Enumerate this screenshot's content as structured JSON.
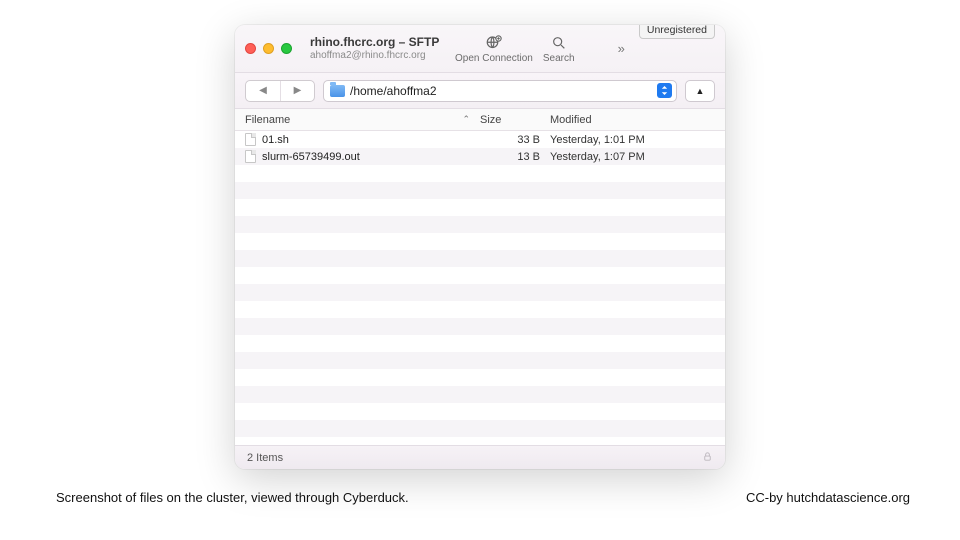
{
  "window": {
    "title": "rhino.fhcrc.org – SFTP",
    "subtitle": "ahoffma2@rhino.fhcrc.org"
  },
  "toolbar": {
    "open_connection": "Open Connection",
    "search": "Search",
    "unregistered": "Unregistered"
  },
  "path": "/home/ahoffma2",
  "columns": {
    "name": "Filename",
    "size": "Size",
    "modified": "Modified"
  },
  "files": [
    {
      "name": "01.sh",
      "size": "33 B",
      "modified": "Yesterday, 1:01 PM"
    },
    {
      "name": "slurm-65739499.out",
      "size": "13 B",
      "modified": "Yesterday, 1:07 PM"
    }
  ],
  "status": {
    "items": "2 Items"
  },
  "caption": {
    "left": "Screenshot of files on the cluster, viewed through Cyberduck.",
    "right": "CC-by hutchdatascience.org"
  }
}
